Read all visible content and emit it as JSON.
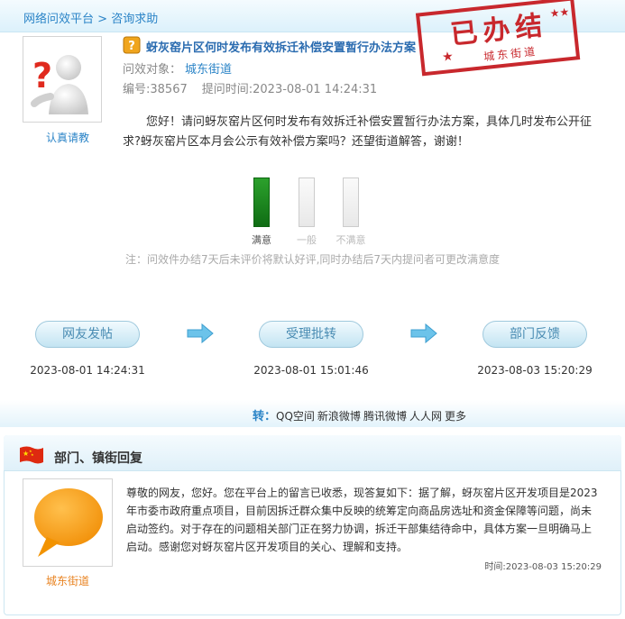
{
  "breadcrumb": {
    "root": "网络问效平台",
    "separator": " > ",
    "current": "咨询求助"
  },
  "stamp": {
    "main": "已办结",
    "sub": "城东街道"
  },
  "question": {
    "avatar_label": "认真请教",
    "title": "蚜灰窑片区何时发布有效拆迁补偿安置暂行办法方案",
    "target_label": "问效对象：",
    "target_value": "城东街道",
    "number": "编号:38567",
    "time": "提问时间:2023-08-01 14:24:31",
    "body": "您好！请问蚜灰窑片区何时发布有效拆迁补偿安置暂行办法方案，具体几时发布公开征求?蚜灰窑片区本月会公示有效补偿方案吗？还望街道解答，谢谢！"
  },
  "rating": {
    "options": [
      {
        "label": "满意",
        "selected": true
      },
      {
        "label": "一般",
        "selected": false
      },
      {
        "label": "不满意",
        "selected": false
      }
    ],
    "note": "注：问效件办结7天后未评价将默认好评,同时办结后7天内提问者可更改满意度"
  },
  "process": {
    "steps": [
      {
        "label": "网友发帖",
        "time": "2023-08-01 14:24:31"
      },
      {
        "label": "受理批转",
        "time": "2023-08-01 15:01:46"
      },
      {
        "label": "部门反馈",
        "time": "2023-08-03 15:20:29"
      }
    ]
  },
  "share": {
    "label": "转：",
    "links": [
      "QQ空间",
      "新浪微博",
      "腾讯微博",
      "人人网",
      "更多"
    ]
  },
  "reply": {
    "title": "部门、镇街回复",
    "avatar_label": "城东街道",
    "body": "尊敬的网友，您好。您在平台上的留言已收悉，现答复如下：据了解，蚜灰窑片区开发项目是2023年市委市政府重点项目，目前因拆迁群众集中反映的统筹定向商品房选址和资金保障等问题，尚未启动签约。对于存在的问题相关部门正在努力协调，拆迁干部集结待命中，具体方案一旦明确马上启动。感谢您对蚜灰窑片区开发项目的关心、理解和支持。",
    "time": "时间:2023-08-03 15:20:29"
  },
  "colors": {
    "accent": "#2b84c7",
    "satisfied": "#138a1a",
    "stamp": "#c8282d"
  }
}
